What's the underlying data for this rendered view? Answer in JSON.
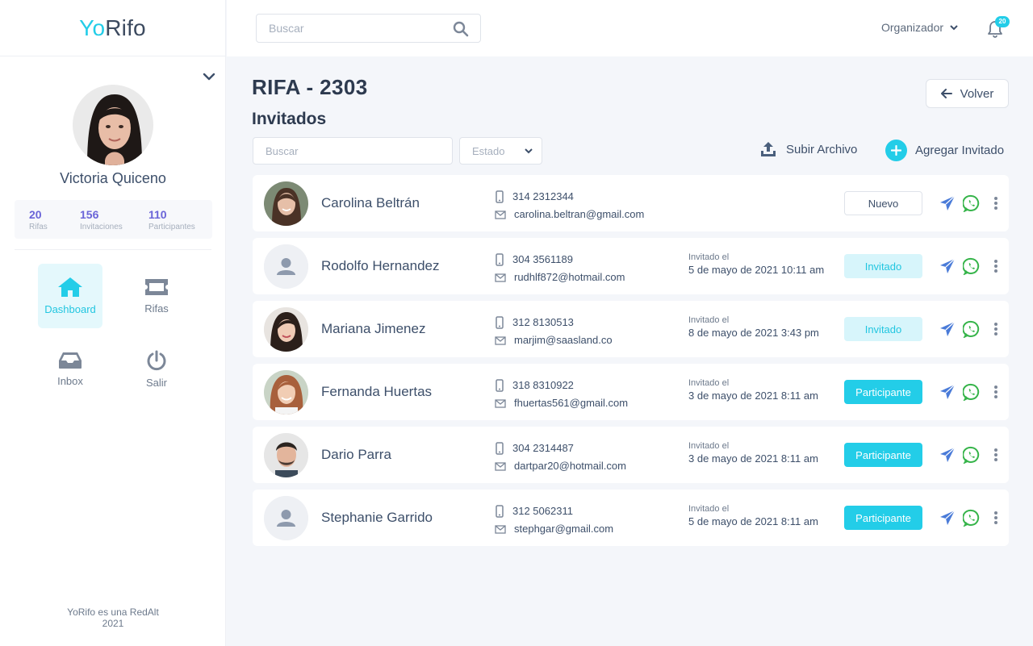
{
  "brand": {
    "yo": "Yo",
    "rifo": "Rifo"
  },
  "profile": {
    "name": "Victoria Quiceno",
    "stats": [
      {
        "value": "20",
        "label": "Rifas"
      },
      {
        "value": "156",
        "label": "Invitaciones"
      },
      {
        "value": "110",
        "label": "Participantes"
      }
    ]
  },
  "nav": {
    "dashboard": "Dashboard",
    "rifas": "Rifas",
    "inbox": "Inbox",
    "salir": "Salir"
  },
  "footer": {
    "line1": "YoRifo es una RedAlt",
    "line2": "2021"
  },
  "topbar": {
    "search_placeholder": "Buscar",
    "role": "Organizador",
    "notifications": "20"
  },
  "page": {
    "title": "RIFA - 2303",
    "section": "Invitados",
    "back": "Volver",
    "filter_placeholder": "Buscar",
    "estado": "Estado",
    "upload": "Subir Archivo",
    "add": "Agregar Invitado"
  },
  "guests": [
    {
      "name": "Carolina Beltrán",
      "phone": "314 2312344",
      "email": "carolina.beltran@gmail.com",
      "invited_label": "",
      "invited_date": "",
      "status": "Nuevo",
      "status_kind": "nuevo",
      "avatar": "photo-1"
    },
    {
      "name": "Rodolfo Hernandez",
      "phone": "304 3561189",
      "email": "rudhlf872@hotmail.com",
      "invited_label": "Invitado el",
      "invited_date": "5 de mayo de 2021 10:11 am",
      "status": "Invitado",
      "status_kind": "invitado",
      "avatar": "placeholder"
    },
    {
      "name": "Mariana Jimenez",
      "phone": "312 8130513",
      "email": "marjim@saasland.co",
      "invited_label": "Invitado el",
      "invited_date": "8 de mayo de 2021 3:43 pm",
      "status": "Invitado",
      "status_kind": "invitado",
      "avatar": "photo-2"
    },
    {
      "name": "Fernanda Huertas",
      "phone": "318 8310922",
      "email": "fhuertas561@gmail.com",
      "invited_label": "Invitado el",
      "invited_date": "3 de mayo de 2021 8:11 am",
      "status": "Participante",
      "status_kind": "participante",
      "avatar": "photo-3"
    },
    {
      "name": "Dario Parra",
      "phone": "304 2314487",
      "email": "dartpar20@hotmail.com",
      "invited_label": "Invitado el",
      "invited_date": "3 de mayo de 2021 8:11 am",
      "status": "Participante",
      "status_kind": "participante",
      "avatar": "photo-4"
    },
    {
      "name": "Stephanie Garrido",
      "phone": "312 5062311",
      "email": "stephgar@gmail.com",
      "invited_label": "Invitado el",
      "invited_date": "5 de mayo de 2021 8:11 am",
      "status": "Participante",
      "status_kind": "participante",
      "avatar": "placeholder"
    }
  ],
  "colors": {
    "accent": "#23cde8",
    "stat": "#6a64d8",
    "send": "#4a7bd8",
    "whatsapp": "#36b44a"
  }
}
